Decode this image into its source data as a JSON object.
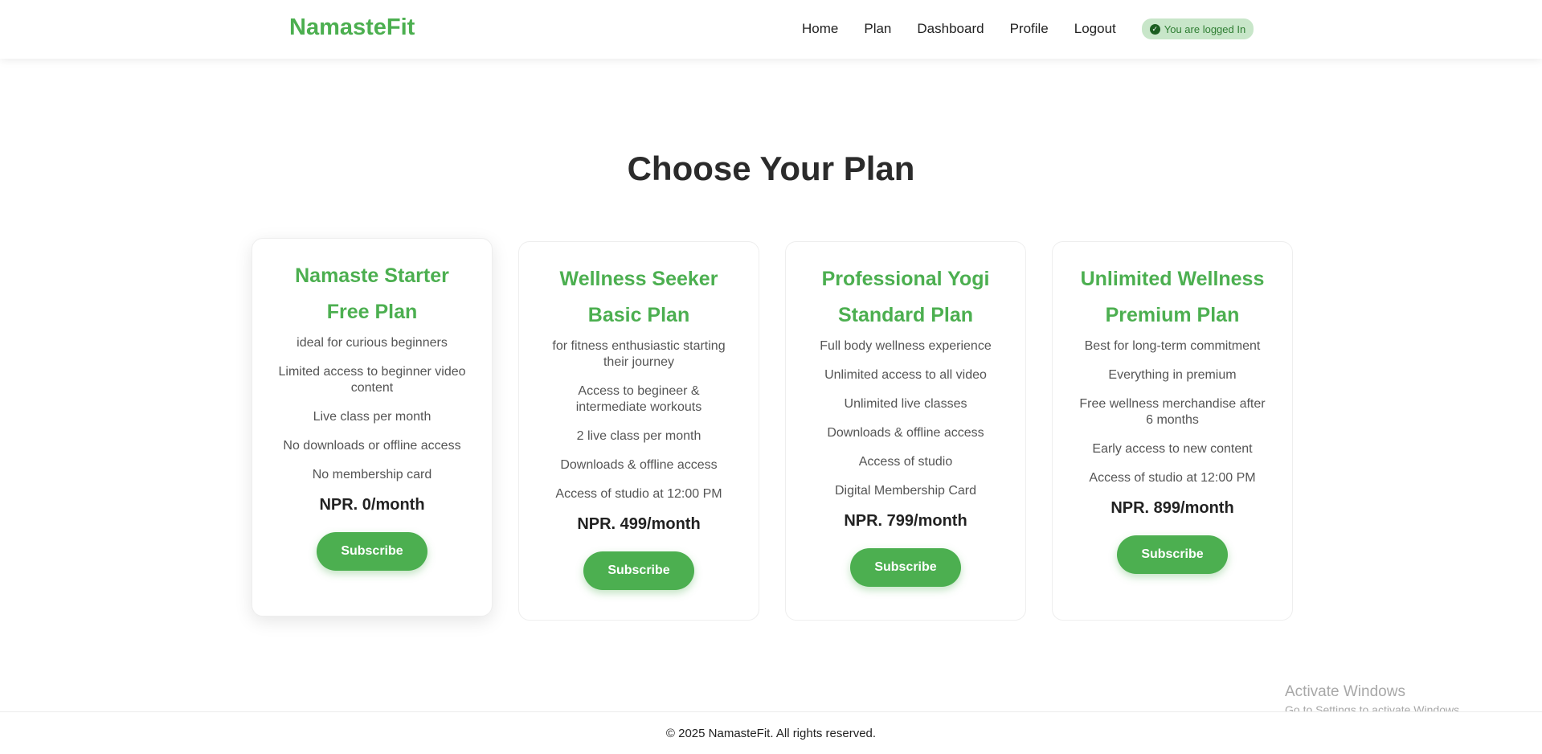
{
  "header": {
    "brand": "NamasteFit",
    "nav": [
      "Home",
      "Plan",
      "Dashboard",
      "Profile",
      "Logout"
    ],
    "login_badge": "You are logged In"
  },
  "main": {
    "title": "Choose Your Plan",
    "plans": [
      {
        "name": "Namaste Starter",
        "tier": "Free Plan",
        "features": [
          "ideal for curious beginners",
          "Limited access to beginner video content",
          "Live class per month",
          "No downloads or offline access",
          "No membership card"
        ],
        "price": "NPR. 0/month",
        "button": "Subscribe"
      },
      {
        "name": "Wellness Seeker",
        "tier": "Basic Plan",
        "features": [
          "for fitness enthusiastic starting their journey",
          "Access to begineer & intermediate workouts",
          "2 live class per month",
          "Downloads & offline access",
          "Access of studio at 12:00 PM"
        ],
        "price": "NPR. 499/month",
        "button": "Subscribe"
      },
      {
        "name": "Professional Yogi",
        "tier": "Standard Plan",
        "features": [
          "Full body wellness experience",
          "Unlimited access to all video",
          "Unlimited live classes",
          "Downloads & offline access",
          "Access of studio",
          "Digital Membership Card"
        ],
        "price": "NPR. 799/month",
        "button": "Subscribe"
      },
      {
        "name": "Unlimited Wellness",
        "tier": "Premium Plan",
        "features": [
          "Best for long-term commitment",
          "Everything in premium",
          "Free wellness merchandise after 6 months",
          "Early access to new content",
          "Access of studio at 12:00 PM"
        ],
        "price": "NPR. 899/month",
        "button": "Subscribe"
      }
    ]
  },
  "watermark": {
    "title": "Activate Windows",
    "subtitle": "Go to Settings to activate Windows."
  },
  "footer": {
    "text": "© 2025 NamasteFit. All rights reserved."
  },
  "colors": {
    "accent": "#4caf50",
    "badge_bg": "#c8e6c9",
    "badge_text": "#2e7d32"
  },
  "icons": {
    "login_badge": "check-circle-icon"
  }
}
